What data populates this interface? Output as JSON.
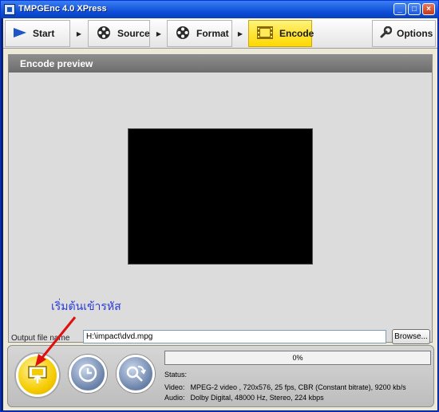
{
  "window": {
    "title": "TMPGEnc 4.0 XPress",
    "controls": [
      "_",
      "□",
      "×"
    ]
  },
  "steps": [
    {
      "label": "Start",
      "icon": "play-arrow-icon",
      "active": false
    },
    {
      "label": "Source",
      "icon": "film-reel-icon",
      "active": false
    },
    {
      "label": "Format",
      "icon": "film-reel-icon",
      "active": false
    },
    {
      "label": "Encode",
      "icon": "film-strip-icon",
      "active": true
    },
    {
      "label": "Options",
      "icon": "wrench-icon",
      "active": false
    }
  ],
  "preview": {
    "header": "Encode preview"
  },
  "annotation": {
    "text": "เริ่มต้นเข้ารหัส",
    "color": "#2a3bd8",
    "arrow_color": "#e01010"
  },
  "output": {
    "label": "Output file name",
    "value": "H:\\impact\\dvd.mpg",
    "browse_label": "Browse..."
  },
  "progress": {
    "percent_text": "0%",
    "value": 0
  },
  "status": {
    "label": "Status:",
    "video_key": "Video:",
    "video_value": "MPEG-2 video , 720x576, 25 fps, CBR (Constant bitrate), 9200 kb/s",
    "audio_key": "Audio:",
    "audio_value": "Dolby Digital, 48000 Hz, Stereo, 224 kbps"
  },
  "colors": {
    "active_step": "#ffd800",
    "panel_header": "#7a7a7a",
    "encode_button": "#f5cc00"
  }
}
